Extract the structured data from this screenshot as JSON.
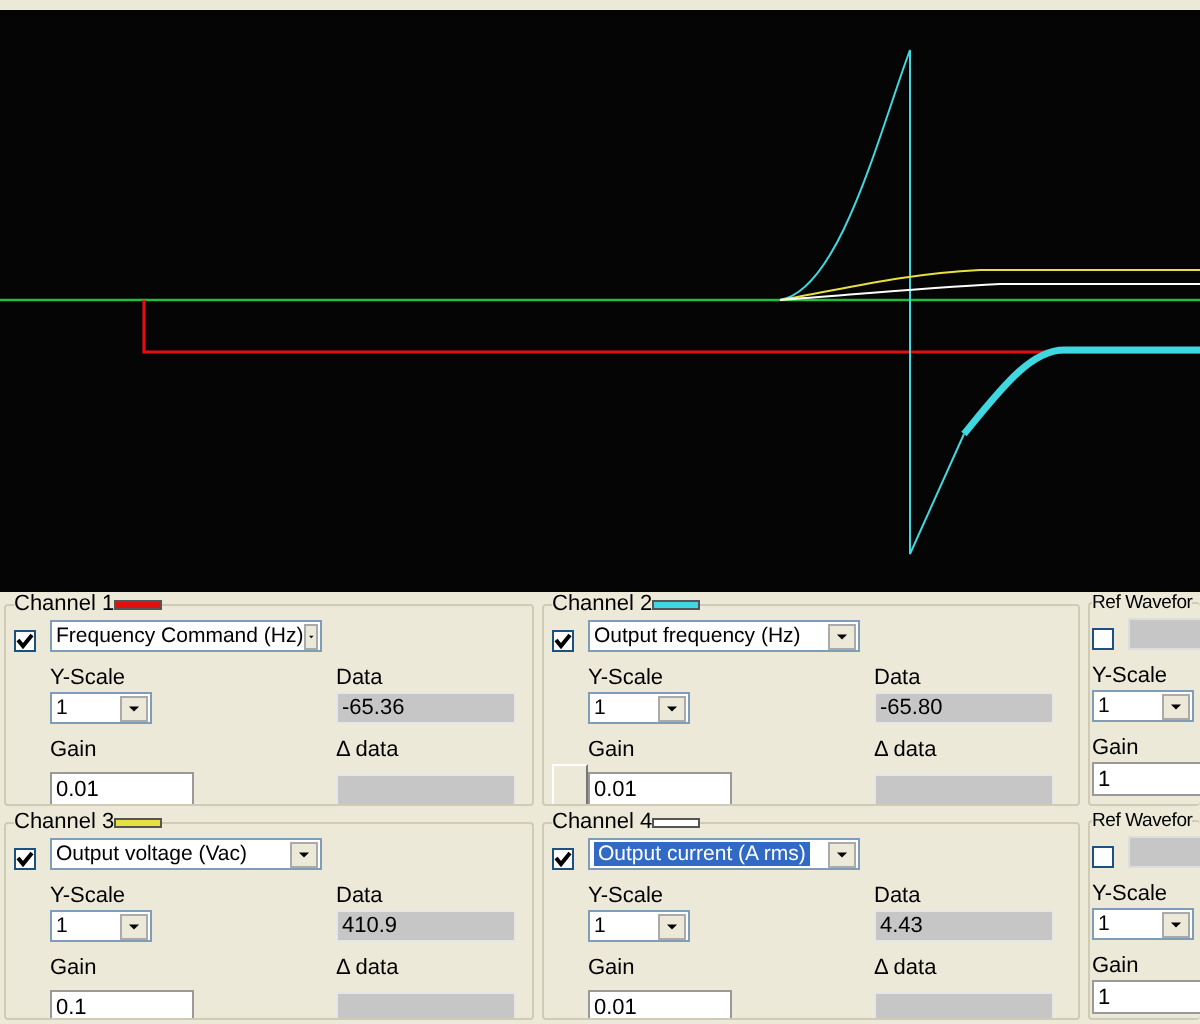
{
  "panels": [
    {
      "kind": "channel",
      "title": "Channel 1",
      "color": "#e01010",
      "enabled": true,
      "signal": "Frequency Command (Hz)",
      "signal_focused": false,
      "y_scale_label": "Y-Scale",
      "y_scale": "1",
      "data_label": "Data",
      "data": "-65.36",
      "gain_label": "Gain",
      "gain": "0.01",
      "delta_label": "Δ data",
      "side_button": false
    },
    {
      "kind": "channel",
      "title": "Channel 2",
      "color": "#40d8e0",
      "enabled": true,
      "signal": "Output frequency (Hz)",
      "signal_focused": false,
      "y_scale_label": "Y-Scale",
      "y_scale": "1",
      "data_label": "Data",
      "data": "-65.80",
      "gain_label": "Gain",
      "gain": "0.01",
      "delta_label": "Δ data",
      "side_button": true
    },
    {
      "kind": "ref",
      "title": "Ref Wavefor",
      "enabled": false,
      "y_scale_label": "Y-Scale",
      "y_scale": "1",
      "gain_label": "Gain",
      "gain": "1"
    },
    {
      "kind": "channel",
      "title": "Channel 3",
      "color": "#e8e040",
      "enabled": true,
      "signal": "Output voltage (Vac)",
      "signal_focused": false,
      "y_scale_label": "Y-Scale",
      "y_scale": "1",
      "data_label": "Data",
      "data": "410.9",
      "gain_label": "Gain",
      "gain": "0.1",
      "delta_label": "Δ data",
      "side_button": false
    },
    {
      "kind": "channel",
      "title": "Channel 4",
      "color": "#ffffff",
      "enabled": true,
      "signal": "Output current (A rms)",
      "signal_focused": true,
      "y_scale_label": "Y-Scale",
      "y_scale": "1",
      "data_label": "Data",
      "data": "4.43",
      "gain_label": "Gain",
      "gain": "0.01",
      "delta_label": "Δ data",
      "side_button": false
    },
    {
      "kind": "ref",
      "title": "Ref Wavefor",
      "enabled": false,
      "y_scale_label": "Y-Scale",
      "y_scale": "1",
      "gain_label": "Gain",
      "gain": "1"
    }
  ]
}
